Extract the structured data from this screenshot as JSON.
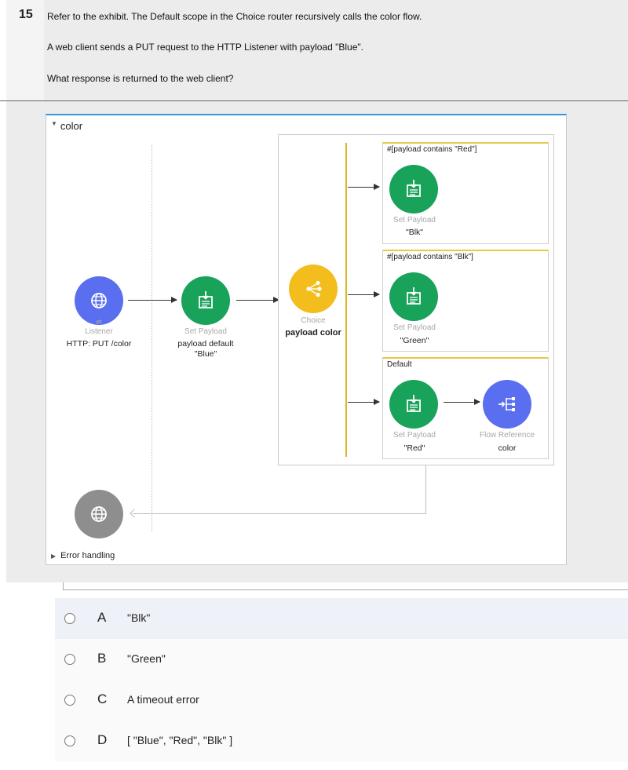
{
  "question": {
    "number": "15",
    "line1": "Refer to the exhibit. The Default scope in the Choice router recursively calls the color flow.",
    "line2": "A web client sends a PUT request to the HTTP Listener with payload \"Blue\".",
    "line3": "What response is returned to the web client?"
  },
  "flow": {
    "name": "color",
    "error_handling": "Error handling",
    "listener": {
      "type": "Listener",
      "name": "HTTP: PUT /color",
      "icon": "globe-icon"
    },
    "set_payload_default": {
      "type": "Set Payload",
      "name_line1": "payload default",
      "name_line2": "\"Blue\""
    },
    "choice": {
      "type": "Choice",
      "name": "payload color"
    },
    "routes": [
      {
        "condition": "#[payload contains \"Red\"]",
        "type": "Set Payload",
        "value": "\"Blk\""
      },
      {
        "condition": "#[payload contains \"Blk\"]",
        "type": "Set Payload",
        "value": "\"Green\""
      },
      {
        "condition": "Default",
        "type": "Set Payload",
        "value": "\"Red\"",
        "flow_ref": {
          "type": "Flow Reference",
          "name": "color"
        }
      }
    ]
  },
  "answers": [
    {
      "letter": "A",
      "text": "\"Blk\""
    },
    {
      "letter": "B",
      "text": "\"Green\""
    },
    {
      "letter": "C",
      "text": "A timeout error"
    },
    {
      "letter": "D",
      "text": "[ \"Blue\", \"Red\", \"Blk\" ]"
    }
  ],
  "colors": {
    "listener": "#5a6ff0",
    "set_payload": "#19a35a",
    "choice": "#f2bd1d",
    "response": "#8e8e8e",
    "flow_border": "#3e95d6"
  }
}
